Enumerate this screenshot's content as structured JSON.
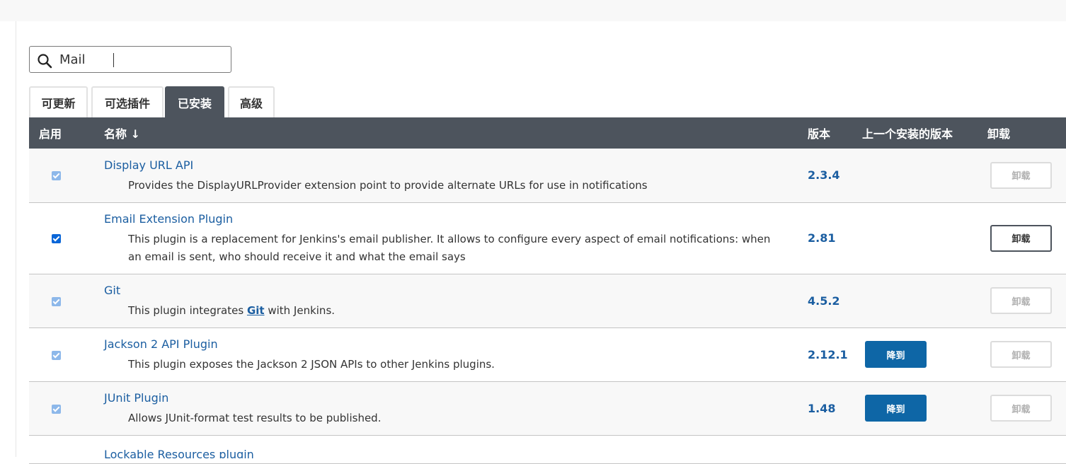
{
  "search": {
    "value": "Mail"
  },
  "tabs": [
    {
      "label": "可更新",
      "active": false
    },
    {
      "label": "可选插件",
      "active": false
    },
    {
      "label": "已安装",
      "active": true
    },
    {
      "label": "高级",
      "active": false
    }
  ],
  "table": {
    "headers": {
      "enabled": "启用",
      "name": "名称 ↓",
      "version": "版本",
      "previous": "上一个安装的版本",
      "uninstall": "卸载"
    },
    "rows": [
      {
        "name": "Display URL API",
        "desc": "Provides the DisplayURLProvider extension point to provide alternate URLs for use in notifications",
        "version": "2.3.4",
        "downgrade": "",
        "uninstall": "卸载",
        "checked_enabled": false
      },
      {
        "name": "Email Extension Plugin",
        "desc": "This plugin is a replacement for Jenkins's email publisher. It allows to configure every aspect of email notifications: when an email is sent, who should receive it and what the email says",
        "version": "2.81",
        "downgrade": "",
        "uninstall": "卸载",
        "checked_enabled": true
      },
      {
        "name": "Git",
        "desc_prefix": "This plugin integrates ",
        "desc_link": "Git",
        "desc_suffix": " with Jenkins.",
        "version": "4.5.2",
        "downgrade": "",
        "uninstall": "卸载",
        "checked_enabled": false
      },
      {
        "name": "Jackson 2 API Plugin",
        "desc": "This plugin exposes the Jackson 2 JSON APIs to other Jenkins plugins.",
        "version": "2.12.1",
        "downgrade": "降到",
        "uninstall": "卸载",
        "checked_enabled": false
      },
      {
        "name": "JUnit Plugin",
        "desc": "Allows JUnit-format test results to be published.",
        "version": "1.48",
        "downgrade": "降到",
        "uninstall": "卸载",
        "checked_enabled": false
      },
      {
        "name": "Lockable Resources plugin"
      }
    ]
  },
  "colors": {
    "header_bg": "#4d545d",
    "link": "#1b5ea1",
    "button": "#0e66a6",
    "row_alt": "#f8f8f8"
  }
}
